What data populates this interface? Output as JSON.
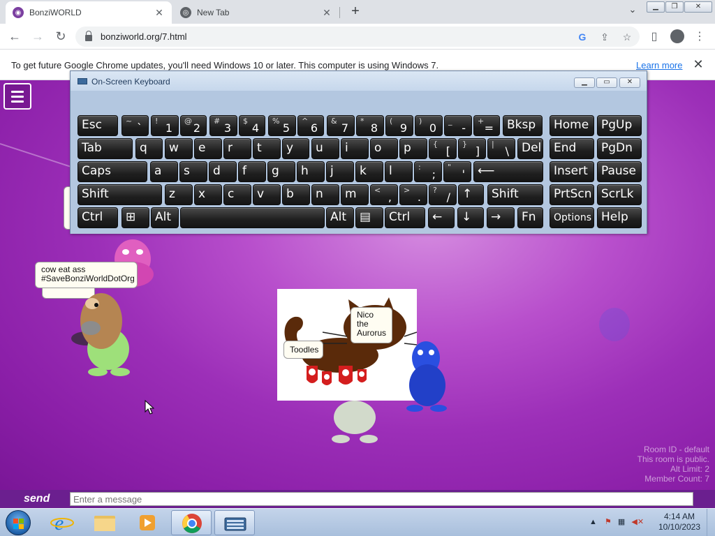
{
  "browser": {
    "tabs": [
      {
        "title": "BonziWORLD",
        "active": true
      },
      {
        "title": "New Tab",
        "active": false
      }
    ],
    "url": "bonziworld.org/7.html",
    "infobar": {
      "message": "To get future Google Chrome updates, you'll need Windows 10 or later. This computer is using Windows 7.",
      "link": "Learn more"
    }
  },
  "osk": {
    "title": "On-Screen Keyboard",
    "rows": [
      [
        {
          "main": "Esc"
        },
        {
          "top": "~",
          "bot": "`"
        },
        {
          "top": "!",
          "bot": "1"
        },
        {
          "top": "@",
          "bot": "2"
        },
        {
          "top": "#",
          "bot": "3"
        },
        {
          "top": "$",
          "bot": "4"
        },
        {
          "top": "%",
          "bot": "5"
        },
        {
          "top": "^",
          "bot": "6"
        },
        {
          "top": "&",
          "bot": "7"
        },
        {
          "top": "*",
          "bot": "8"
        },
        {
          "top": "(",
          "bot": "9"
        },
        {
          "top": ")",
          "bot": "0"
        },
        {
          "top": "_",
          "bot": "-"
        },
        {
          "top": "+",
          "bot": "="
        },
        {
          "main": "Bksp"
        },
        {
          "main": "Home"
        },
        {
          "main": "PgUp"
        }
      ],
      [
        {
          "main": "Tab"
        },
        {
          "main": "q"
        },
        {
          "main": "w"
        },
        {
          "main": "e"
        },
        {
          "main": "r"
        },
        {
          "main": "t"
        },
        {
          "main": "y"
        },
        {
          "main": "u"
        },
        {
          "main": "i"
        },
        {
          "main": "o"
        },
        {
          "main": "p"
        },
        {
          "top": "{",
          "bot": "["
        },
        {
          "top": "}",
          "bot": "]"
        },
        {
          "top": "|",
          "bot": "\\"
        },
        {
          "main": "Del"
        },
        {
          "main": "End"
        },
        {
          "main": "PgDn"
        }
      ],
      [
        {
          "main": "Caps"
        },
        {
          "main": "a"
        },
        {
          "main": "s"
        },
        {
          "main": "d"
        },
        {
          "main": "f"
        },
        {
          "main": "g"
        },
        {
          "main": "h"
        },
        {
          "main": "j"
        },
        {
          "main": "k"
        },
        {
          "main": "l"
        },
        {
          "top": ":",
          "bot": ";"
        },
        {
          "top": "\"",
          "bot": "'"
        },
        {
          "main": "⟵"
        },
        {
          "main": "Insert"
        },
        {
          "main": "Pause"
        }
      ],
      [
        {
          "main": "Shift"
        },
        {
          "main": "z"
        },
        {
          "main": "x"
        },
        {
          "main": "c"
        },
        {
          "main": "v"
        },
        {
          "main": "b"
        },
        {
          "main": "n"
        },
        {
          "main": "m"
        },
        {
          "top": "<",
          "bot": ","
        },
        {
          "top": ">",
          "bot": "."
        },
        {
          "top": "?",
          "bot": "/"
        },
        {
          "main": "↑"
        },
        {
          "main": "Shift"
        },
        {
          "main": "PrtScn"
        },
        {
          "main": "ScrLk"
        }
      ],
      [
        {
          "main": "Ctrl"
        },
        {
          "main": "⊞"
        },
        {
          "main": "Alt"
        },
        {
          "main": ""
        },
        {
          "main": "Alt"
        },
        {
          "main": "▤"
        },
        {
          "main": "Ctrl"
        },
        {
          "main": "←"
        },
        {
          "main": "↓"
        },
        {
          "main": "→"
        },
        {
          "main": "Fn"
        },
        {
          "main": "Options",
          "small": true
        },
        {
          "main": "Help"
        }
      ]
    ]
  },
  "page": {
    "bubbles": {
      "cow": "cow eat ass #SaveBonziWorldDotOrg",
      "nico": "Nico the Aurorus",
      "toodles": "Toodles"
    },
    "room_info": [
      "Room ID - default",
      "This room is public.",
      "Alt Limit: 2",
      "Member Count: 7"
    ],
    "send_label": "send",
    "message_placeholder": "Enter a message"
  },
  "taskbar": {
    "time": "4:14 AM",
    "date": "10/10/2023"
  },
  "colors": {
    "page_bg": "#9c2fb8",
    "chat_bar": "#6b1f8f",
    "chrome_tabstrip": "#dee1e6"
  }
}
